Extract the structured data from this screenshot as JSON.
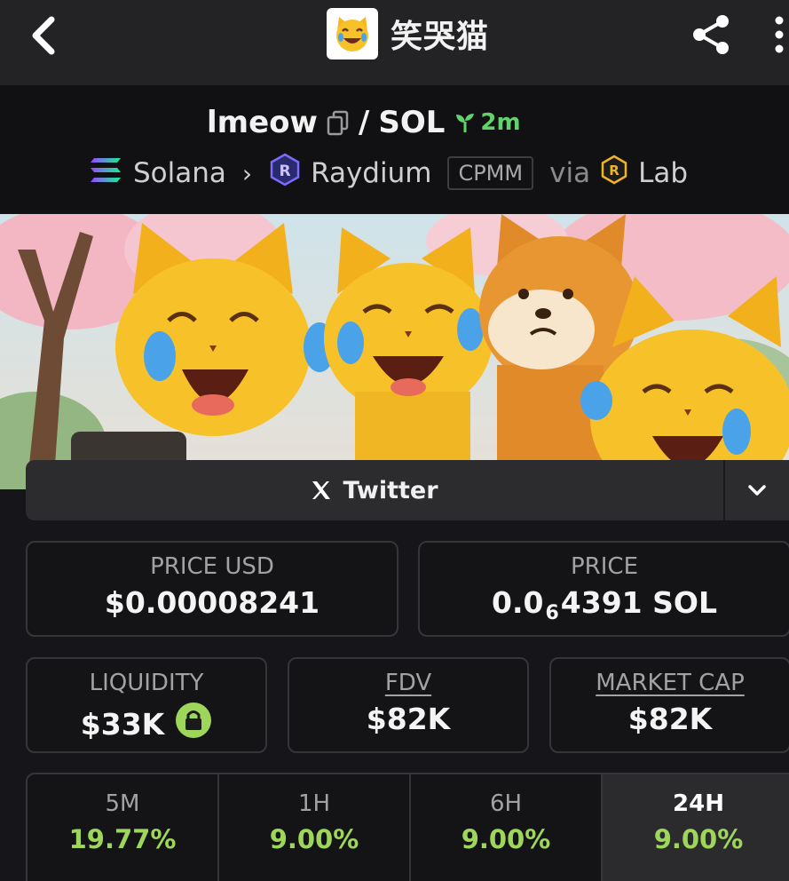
{
  "header": {
    "title": "笑哭猫",
    "logo_icon": "joy-cat-icon",
    "back_icon": "back-chevron-icon",
    "share_icon": "share-icon",
    "more_icon": "more-vertical-icon"
  },
  "pair": {
    "base": "lmeow",
    "separator": "/",
    "quote": "SOL",
    "age": "2m",
    "age_icon": "seedling-icon",
    "copy_icon": "copy-icon"
  },
  "route": {
    "chain": "Solana",
    "chain_icon": "solana-icon",
    "dex": "Raydium",
    "dex_icon": "raydium-icon",
    "pool_type": "CPMM",
    "via_label": "via",
    "launchpad": "Lab",
    "launchpad_icon": "raydium-lab-icon"
  },
  "socials": {
    "twitter_label": "Twitter",
    "twitter_icon": "x-logo-icon",
    "dropdown_icon": "chevron-down-icon"
  },
  "prices": {
    "usd_label": "PRICE USD",
    "usd_value": "$0.00008241",
    "native_label": "PRICE",
    "native_prefix": "0.0",
    "native_zeros": "6",
    "native_digits": "4391 SOL"
  },
  "stats": {
    "liquidity_label": "LIQUIDITY",
    "liquidity_value": "$33K",
    "liquidity_icon": "lock-icon",
    "fdv_label": "FDV",
    "fdv_value": "$82K",
    "mcap_label": "MARKET CAP",
    "mcap_value": "$82K"
  },
  "timeframes": [
    {
      "label": "5M",
      "change": "19.77%"
    },
    {
      "label": "1H",
      "change": "9.00%"
    },
    {
      "label": "6H",
      "change": "9.00%"
    },
    {
      "label": "24H",
      "change": "9.00%"
    }
  ],
  "colors": {
    "accent_green": "#9ed65b",
    "age_green": "#62d26a",
    "background": "#16161a"
  }
}
